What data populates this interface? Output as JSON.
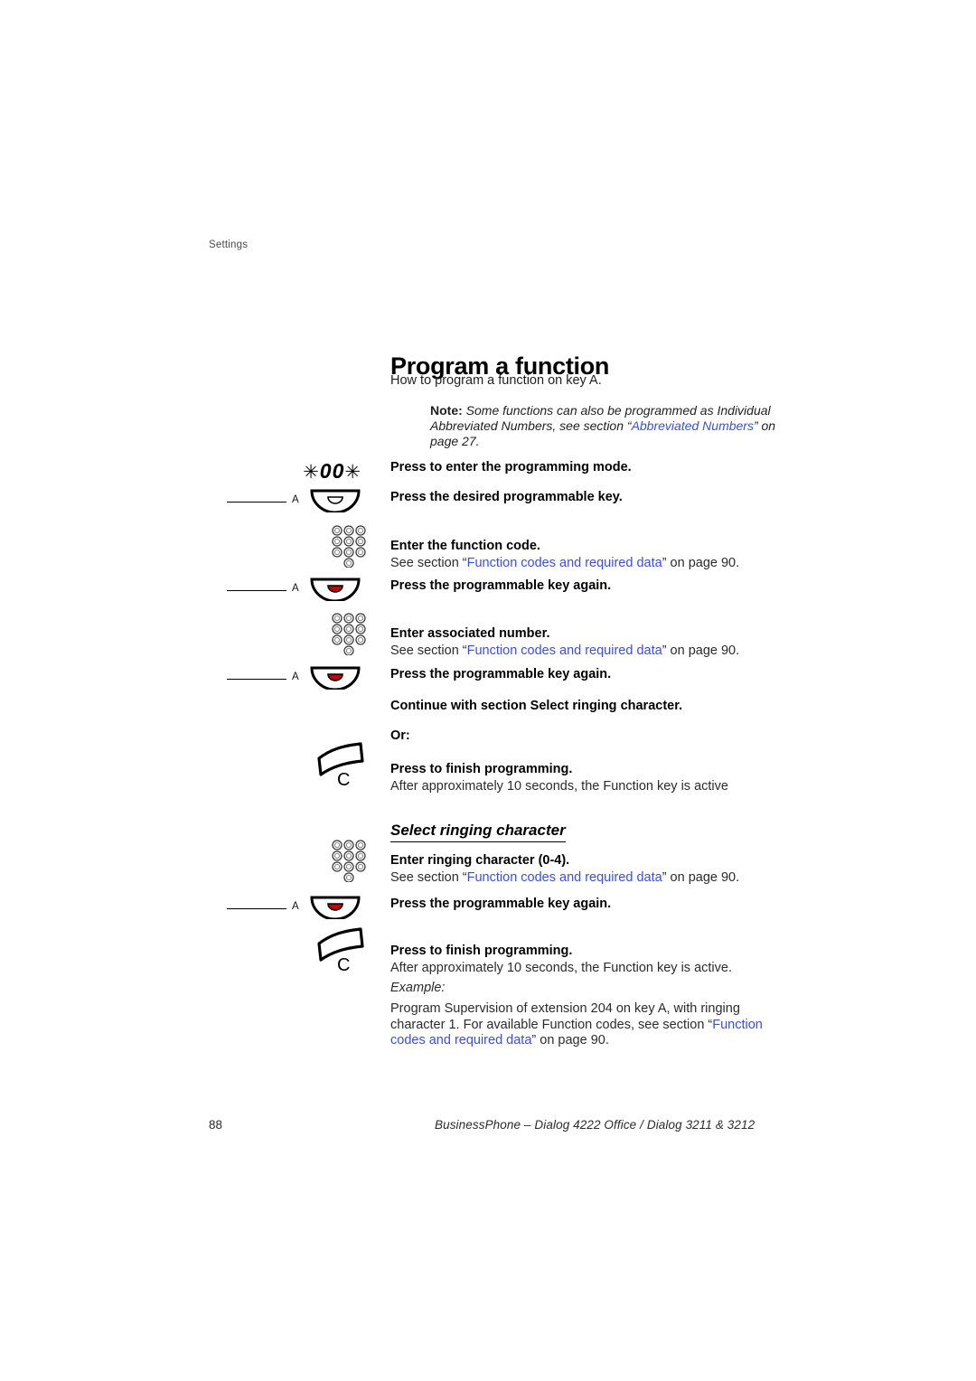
{
  "running_header": "Settings",
  "page_title": "Program a function",
  "intro": "How to program a function on key A.",
  "note": {
    "label": "Note:",
    "text_1": " Some functions can also be programmed as Individual Abbreviated Numbers, see section “",
    "link": "Abbreviated Numbers",
    "text_2": "” on page 27."
  },
  "steps": [
    {
      "icon": "dial-code-star-00-star",
      "code": "00",
      "star": "✳",
      "heading": "Press to enter the programming mode.",
      "sub": ""
    },
    {
      "icon": "programmable-key",
      "key_letter": "A",
      "lamp": "off",
      "heading": "Press the desired programmable key.",
      "sub": ""
    },
    {
      "icon": "keypad",
      "heading": "Enter the function code.",
      "sub_prefix": "See section “",
      "sub_link": "Function codes and required data",
      "sub_suffix": "” on page 90."
    },
    {
      "icon": "programmable-key",
      "key_letter": "A",
      "lamp": "on",
      "heading": "Press the programmable key again.",
      "sub": ""
    },
    {
      "icon": "keypad",
      "heading": "Enter associated number.",
      "sub_prefix": "See section “",
      "sub_link": "Function codes and required data",
      "sub_suffix": "” on page 90."
    },
    {
      "icon": "programmable-key",
      "key_letter": "A",
      "lamp": "on",
      "heading": "Press the programmable key again.",
      "sub": ""
    },
    {
      "icon": "none",
      "heading": "Continue with section Select ringing character.",
      "sub": ""
    },
    {
      "icon": "none",
      "heading": "Or:",
      "sub": ""
    },
    {
      "icon": "clear-key",
      "key_letter": "C",
      "heading": "Press to finish programming.",
      "sub": "After approximately 10 seconds, the Function key is active"
    }
  ],
  "subsection": {
    "title": "Select ringing character",
    "steps": [
      {
        "icon": "keypad",
        "heading": "Enter ringing character (0-4).",
        "sub_prefix": "See section “",
        "sub_link": "Function codes and required data",
        "sub_suffix": "” on page 90."
      },
      {
        "icon": "programmable-key",
        "key_letter": "A",
        "lamp": "on",
        "heading": "Press the programmable key again.",
        "sub": ""
      },
      {
        "icon": "clear-key",
        "key_letter": "C",
        "heading": "Press to finish programming.",
        "sub": "After approximately 10 seconds, the Function key is active."
      }
    ]
  },
  "example": {
    "label": "Example:",
    "text_1": "Program Supervision of extension 204 on key A, with ringing character 1. For available Function codes, see section “",
    "link": "Function codes and required data",
    "text_2": "” on page 90."
  },
  "footer": {
    "page_number": "88",
    "title": "BusinessPhone – Dialog 4222 Office / Dialog  3211 & 3212"
  },
  "colors": {
    "link": "#3b4ee0",
    "lamp_on": "#cc0000",
    "lamp_off": "#ffffff",
    "text": "#1a1a1a"
  }
}
